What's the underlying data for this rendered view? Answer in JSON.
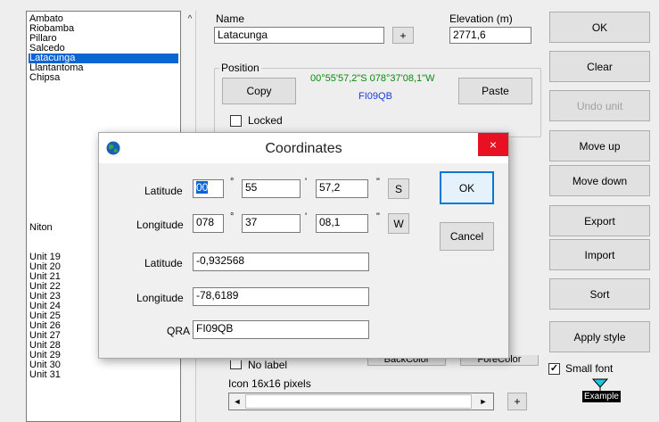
{
  "list": {
    "items": [
      "Ambato",
      "Riobamba",
      "Pillaro",
      "Salcedo",
      "Latacunga",
      "Llantantoma",
      "Chipsa"
    ],
    "selected_index": 4,
    "lower_items": [
      "Niton",
      "Unit  19",
      "Unit  20",
      "Unit  21",
      "Unit  22",
      "Unit  23",
      "Unit  24",
      "Unit  25",
      "Unit  26",
      "Unit  27",
      "Unit  28",
      "Unit  29",
      "Unit  30",
      "Unit  31"
    ],
    "scroll_up": "^"
  },
  "name": {
    "label": "Name",
    "value": "Latacunga",
    "plus": "+"
  },
  "elevation": {
    "label": "Elevation (m)",
    "value": "2771,6"
  },
  "position": {
    "title": "Position",
    "coords": "00°55'57,2\"S 078°37'08,1\"W",
    "locator": "FI09QB",
    "copy": "Copy",
    "paste": "Paste",
    "locked": "Locked"
  },
  "lower_panel": {
    "no_label": "No label",
    "backcolor": "BackColor",
    "forecolor": "ForeColor",
    "icon_label": "Icon 16x16 pixels",
    "plus": "+",
    "arrow_left": "◄",
    "arrow_right": "►"
  },
  "side_buttons": {
    "ok": "OK",
    "clear": "Clear",
    "undo_unit": "Undo unit",
    "move_up": "Move up",
    "move_down": "Move down",
    "export": "Export",
    "import": "Import",
    "sort": "Sort",
    "apply_style": "Apply style",
    "small_font": "Small font",
    "example": "Example"
  },
  "dialog": {
    "title": "Coordinates",
    "close": "×",
    "lat_label": "Latitude",
    "lat_deg": "00",
    "lat_min": "55",
    "lat_sec": "57,2",
    "lat_hemi": "S",
    "lon_label": "Longitude",
    "lon_deg": "078",
    "lon_min": "37",
    "lon_sec": "08,1",
    "lon_hemi": "W",
    "lat_dec_label": "Latitude",
    "lat_dec": "-0,932568",
    "lon_dec_label": "Longitude",
    "lon_dec": "-78,6189",
    "qra_label": "QRA",
    "qra": "FI09QB",
    "ok": "OK",
    "cancel": "Cancel",
    "deg_symbol": "°",
    "min_symbol": "'",
    "sec_symbol": "\""
  },
  "colors": {
    "selection": "#0a64d4",
    "coords_green": "#0a8a0a",
    "locator_blue": "#1a3bd6",
    "close_red": "#e81123",
    "example_marker": "#18c8e0"
  }
}
